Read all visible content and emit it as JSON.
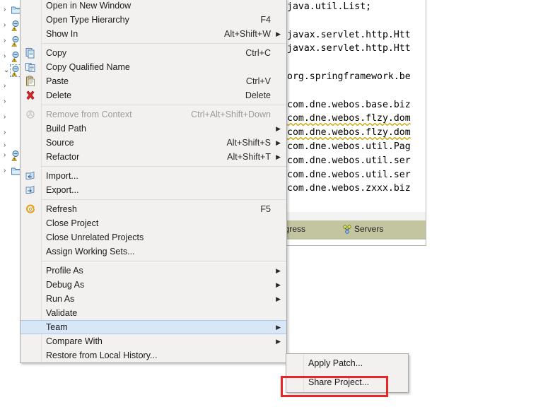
{
  "context_menu": {
    "groups": [
      {
        "items": [
          {
            "label": "Open in New Window",
            "accel": "",
            "arrow": false,
            "icon": "",
            "disabled": false
          },
          {
            "label": "Open Type Hierarchy",
            "accel": "F4",
            "arrow": false,
            "icon": "",
            "disabled": false
          },
          {
            "label": "Show In",
            "accel": "Alt+Shift+W",
            "arrow": true,
            "icon": "",
            "disabled": false
          }
        ]
      },
      {
        "items": [
          {
            "label": "Copy",
            "accel": "Ctrl+C",
            "arrow": false,
            "icon": "copy-icon",
            "disabled": false
          },
          {
            "label": "Copy Qualified Name",
            "accel": "",
            "arrow": false,
            "icon": "copy-qualified-name-icon",
            "disabled": false
          },
          {
            "label": "Paste",
            "accel": "Ctrl+V",
            "arrow": false,
            "icon": "paste-icon",
            "disabled": false
          },
          {
            "label": "Delete",
            "accel": "Delete",
            "arrow": false,
            "icon": "delete-icon",
            "disabled": false
          }
        ]
      },
      {
        "items": [
          {
            "label": "Remove from Context",
            "accel": "Ctrl+Alt+Shift+Down",
            "arrow": false,
            "icon": "remove-from-context-icon",
            "disabled": true
          },
          {
            "label": "Build Path",
            "accel": "",
            "arrow": true,
            "icon": "",
            "disabled": false
          },
          {
            "label": "Source",
            "accel": "Alt+Shift+S",
            "arrow": true,
            "icon": "",
            "disabled": false
          },
          {
            "label": "Refactor",
            "accel": "Alt+Shift+T",
            "arrow": true,
            "icon": "",
            "disabled": false
          }
        ]
      },
      {
        "items": [
          {
            "label": "Import...",
            "accel": "",
            "arrow": false,
            "icon": "import-icon",
            "disabled": false
          },
          {
            "label": "Export...",
            "accel": "",
            "arrow": false,
            "icon": "export-icon",
            "disabled": false
          }
        ]
      },
      {
        "items": [
          {
            "label": "Refresh",
            "accel": "F5",
            "arrow": false,
            "icon": "refresh-icon",
            "disabled": false
          },
          {
            "label": "Close Project",
            "accel": "",
            "arrow": false,
            "icon": "",
            "disabled": false
          },
          {
            "label": "Close Unrelated Projects",
            "accel": "",
            "arrow": false,
            "icon": "",
            "disabled": false
          },
          {
            "label": "Assign Working Sets...",
            "accel": "",
            "arrow": false,
            "icon": "",
            "disabled": false
          }
        ]
      },
      {
        "items": [
          {
            "label": "Profile As",
            "accel": "",
            "arrow": true,
            "icon": "",
            "disabled": false
          },
          {
            "label": "Debug As",
            "accel": "",
            "arrow": true,
            "icon": "",
            "disabled": false
          },
          {
            "label": "Run As",
            "accel": "",
            "arrow": true,
            "icon": "",
            "disabled": false
          },
          {
            "label": "Validate",
            "accel": "",
            "arrow": false,
            "icon": "",
            "disabled": false
          },
          {
            "label": "Team",
            "accel": "",
            "arrow": true,
            "icon": "",
            "disabled": false,
            "highlighted": true
          },
          {
            "label": "Compare With",
            "accel": "",
            "arrow": true,
            "icon": "",
            "disabled": false
          },
          {
            "label": "Restore from Local History...",
            "accel": "",
            "arrow": false,
            "icon": "",
            "disabled": false
          }
        ]
      }
    ]
  },
  "submenu": {
    "items": [
      {
        "label": "Apply Patch...",
        "highlighted": false
      },
      {
        "label": "Share Project...",
        "highlighted": true
      }
    ]
  },
  "annotation": {
    "color": "#e8262a"
  },
  "editor": {
    "lines": [
      {
        "text": "java.util.List;",
        "warn": false
      },
      {
        "text": "",
        "warn": false
      },
      {
        "text": "javax.servlet.http.Htt",
        "warn": false
      },
      {
        "text": "javax.servlet.http.Htt",
        "warn": false
      },
      {
        "text": "",
        "warn": false
      },
      {
        "text": "org.springframework.be",
        "warn": false
      },
      {
        "text": "",
        "warn": false
      },
      {
        "text": "com.dne.webos.base.biz",
        "warn": false
      },
      {
        "text": "com.dne.webos.flzy.dom",
        "warn": true
      },
      {
        "text": "com.dne.webos.flzy.dom",
        "warn": true
      },
      {
        "text": "com.dne.webos.util.Pag",
        "warn": false
      },
      {
        "text": "com.dne.webos.util.ser",
        "warn": false
      },
      {
        "text": "com.dne.webos.util.ser",
        "warn": false
      },
      {
        "text": "com.dne.webos.zxxx.biz",
        "warn": false
      }
    ]
  },
  "view_tabs": {
    "progress_label": "rogress",
    "servers_label": "Servers"
  },
  "tree": {
    "rows": [
      {
        "twisty": "collapsed",
        "icon": "project-icon",
        "selected": false
      },
      {
        "twisty": "collapsed",
        "icon": "project-warning-icon",
        "selected": false
      },
      {
        "twisty": "collapsed",
        "icon": "project-warning-icon",
        "selected": false
      },
      {
        "twisty": "collapsed",
        "icon": "project-warning-icon",
        "selected": false
      },
      {
        "twisty": "expanded",
        "icon": "project-warning-icon",
        "selected": true
      },
      {
        "twisty": "collapsed",
        "icon": "hidden-icon",
        "selected": false
      },
      {
        "twisty": "collapsed",
        "icon": "hidden-icon",
        "selected": false
      },
      {
        "twisty": "collapsed",
        "icon": "hidden-icon",
        "selected": false
      },
      {
        "twisty": "collapsed",
        "icon": "hidden-icon",
        "selected": false
      },
      {
        "twisty": "collapsed",
        "icon": "hidden-icon",
        "selected": false
      },
      {
        "twisty": "collapsed",
        "icon": "project-warning-icon",
        "selected": false
      },
      {
        "twisty": "collapsed",
        "icon": "project-icon",
        "selected": false
      }
    ]
  }
}
